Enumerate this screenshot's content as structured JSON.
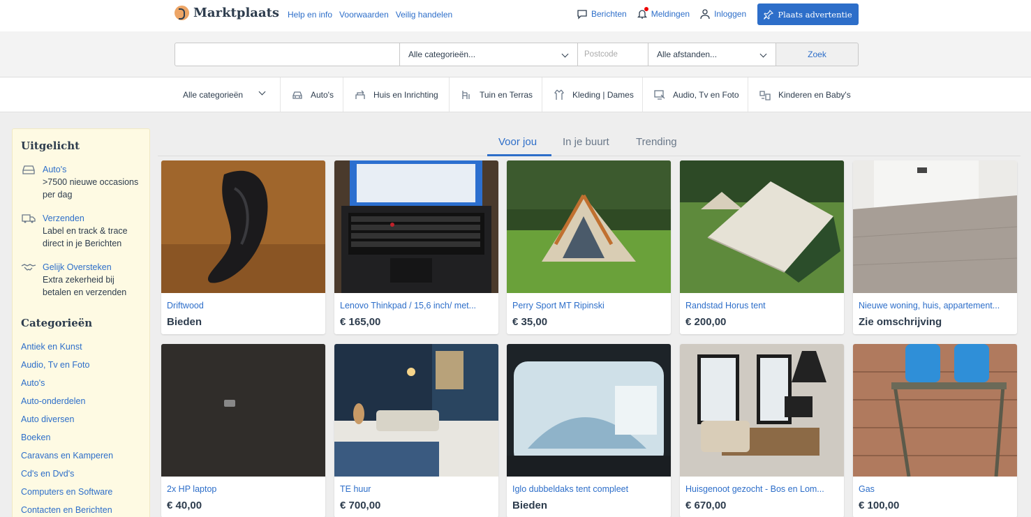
{
  "header": {
    "logo_text": "Marktplaats",
    "links": [
      "Help en info",
      "Voorwaarden",
      "Veilig handelen"
    ],
    "messages_label": "Berichten",
    "notifications_label": "Meldingen",
    "login_label": "Inloggen",
    "place_ad_label": "Plaats advertentie"
  },
  "search": {
    "query_value": "",
    "category_value": "Alle categorieën...",
    "postcode_placeholder": "Postcode",
    "distance_value": "Alle afstanden...",
    "button_label": "Zoek"
  },
  "category_nav": {
    "all_label": "Alle categorieën",
    "items": [
      {
        "label": "Auto's",
        "icon": "car-icon"
      },
      {
        "label": "Huis en Inrichting",
        "icon": "furniture-icon"
      },
      {
        "label": "Tuin en Terras",
        "icon": "garden-icon"
      },
      {
        "label": "Kleding | Dames",
        "icon": "clothing-icon"
      },
      {
        "label": "Audio, Tv en Foto",
        "icon": "tv-icon"
      },
      {
        "label": "Kinderen en Baby's",
        "icon": "baby-icon"
      }
    ]
  },
  "sidebar": {
    "featured_title": "Uitgelicht",
    "featured": [
      {
        "link": "Auto's",
        "desc": ">7500 nieuwe occasions per dag",
        "icon": "car-icon"
      },
      {
        "link": "Verzenden",
        "desc": "Label en track & trace direct in je Berichten",
        "icon": "truck-icon"
      },
      {
        "link": "Gelijk Oversteken",
        "desc": "Extra zekerheid bij betalen en verzenden",
        "icon": "handshake-icon"
      }
    ],
    "categories_title": "Categorieën",
    "categories": [
      "Antiek en Kunst",
      "Audio, Tv en Foto",
      "Auto's",
      "Auto-onderdelen",
      "Auto diversen",
      "Boeken",
      "Caravans en Kamperen",
      "Cd's en Dvd's",
      "Computers en Software",
      "Contacten en Berichten"
    ]
  },
  "feed": {
    "tabs": [
      "Voor jou",
      "In je buurt",
      "Trending"
    ],
    "active_tab": "Voor jou",
    "listings": [
      {
        "title": "Driftwood",
        "price": "Bieden"
      },
      {
        "title": "Lenovo Thinkpad / 15,6 inch/ met...",
        "price": "€ 165,00"
      },
      {
        "title": "Perry Sport MT Ripinski",
        "price": "€ 35,00"
      },
      {
        "title": "Randstad Horus tent",
        "price": "€ 200,00"
      },
      {
        "title": "Nieuwe woning, huis, appartement...",
        "price": "Zie omschrijving"
      },
      {
        "title": "2x HP laptop",
        "price": "€ 40,00"
      },
      {
        "title": "TE huur",
        "price": "€ 700,00"
      },
      {
        "title": "Iglo dubbeldaks tent compleet",
        "price": "Bieden"
      },
      {
        "title": "Huisgenoot gezocht - Bos en Lom...",
        "price": "€ 670,00"
      },
      {
        "title": "Gas",
        "price": "€ 100,00"
      }
    ]
  },
  "colors": {
    "brand_blue": "#2d6ec9",
    "text_dark": "#2d3c4d",
    "sidebar_bg": "#fefae3",
    "logo_orange": "#eda566"
  }
}
